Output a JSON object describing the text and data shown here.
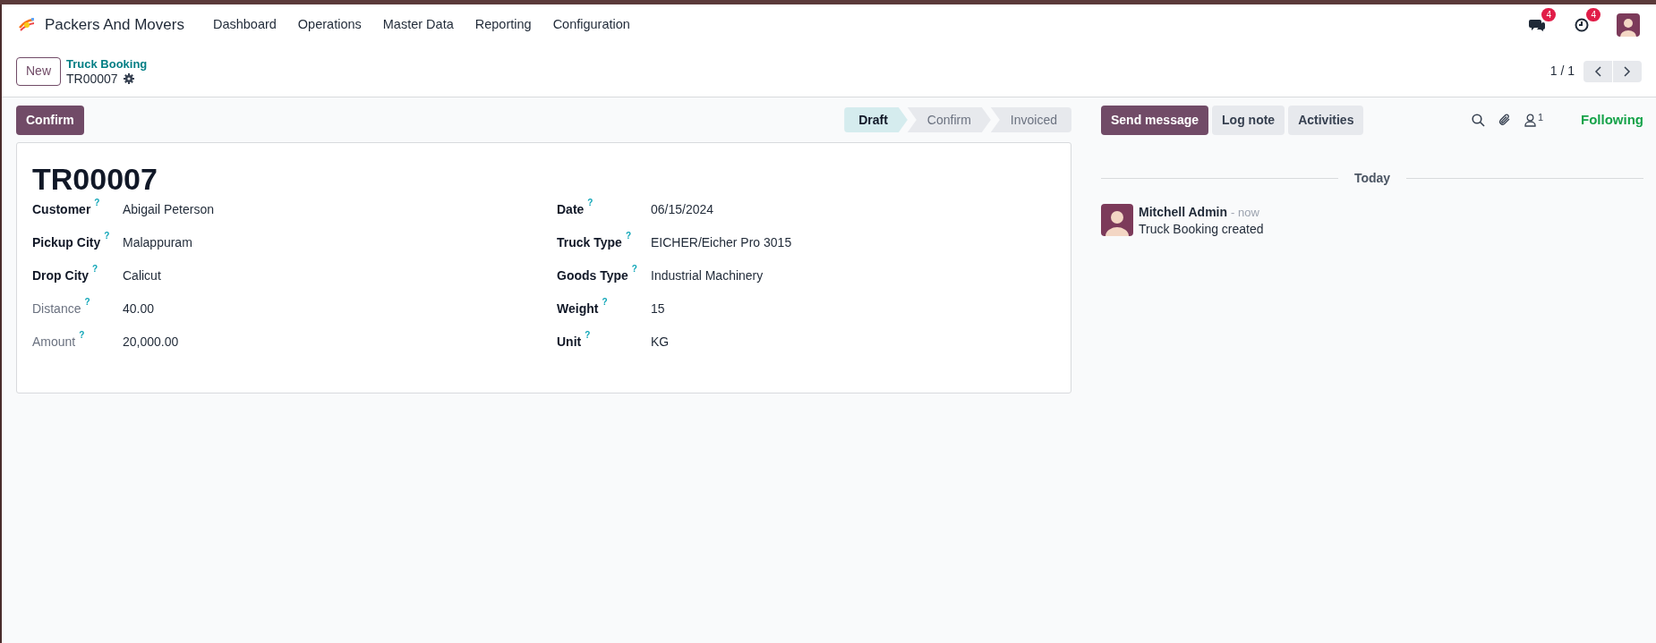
{
  "navbar": {
    "app_name": "Packers And Movers",
    "menu": [
      "Dashboard",
      "Operations",
      "Master Data",
      "Reporting",
      "Configuration"
    ],
    "messages_badge": "4",
    "activities_badge": "4"
  },
  "control_panel": {
    "new_button": "New",
    "breadcrumb": "Truck Booking",
    "record": "TR00007",
    "pager": "1 / 1"
  },
  "action_buttons": [
    "Confirm"
  ],
  "status_bar": [
    {
      "label": "Draft",
      "selected": true
    },
    {
      "label": "Confirm",
      "selected": false
    },
    {
      "label": "Invoiced",
      "selected": false
    }
  ],
  "form": {
    "title": "TR00007",
    "left_fields": [
      {
        "label": "Customer",
        "help": "?",
        "value": "Abigail Peterson",
        "readonly": false
      },
      {
        "label": "Pickup City",
        "help": "?",
        "value": "Malappuram",
        "readonly": false
      },
      {
        "label": "Drop City",
        "help": "?",
        "value": "Calicut",
        "readonly": false
      },
      {
        "label": "Distance",
        "help": "?",
        "value": "40.00",
        "readonly": true
      },
      {
        "label": "Amount",
        "help": "?",
        "value": "20,000.00",
        "readonly": true
      }
    ],
    "right_fields": [
      {
        "label": "Date",
        "help": "?",
        "value": "06/15/2024",
        "readonly": false
      },
      {
        "label": "Truck Type",
        "help": "?",
        "value": "EICHER/Eicher Pro 3015",
        "readonly": false
      },
      {
        "label": "Goods Type",
        "help": "?",
        "value": "Industrial Machinery",
        "readonly": false
      },
      {
        "label": "Weight",
        "help": "?",
        "value": "15",
        "readonly": false
      },
      {
        "label": "Unit",
        "help": "?",
        "value": "KG",
        "readonly": false
      }
    ]
  },
  "chatter": {
    "buttons": [
      {
        "label": "Send message",
        "selected": true
      },
      {
        "label": "Log note",
        "selected": false
      },
      {
        "label": "Activities",
        "selected": false
      }
    ],
    "followers_count": "1",
    "following": "Following",
    "date_separator": "Today",
    "messages": [
      {
        "author": "Mitchell Admin",
        "time": "- now",
        "body": "Truck Booking created"
      }
    ]
  }
}
